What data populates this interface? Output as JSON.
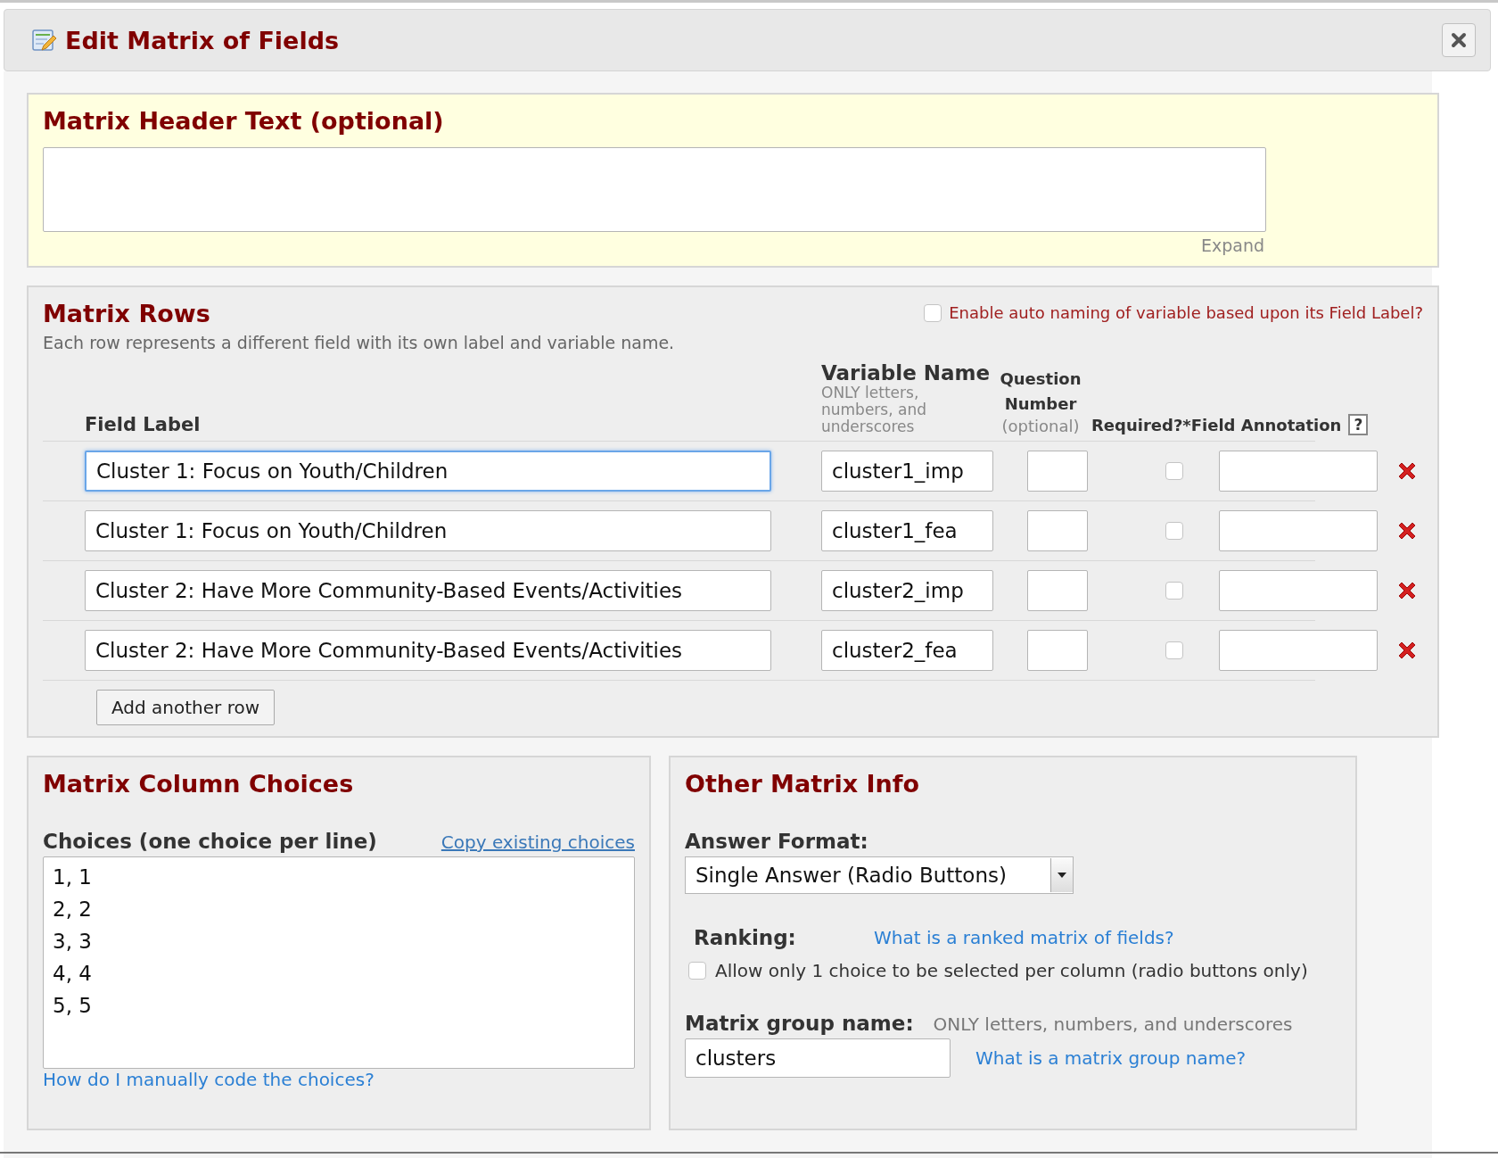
{
  "dialog": {
    "title": "Edit Matrix of Fields"
  },
  "header_section": {
    "title": "Matrix Header Text (optional)",
    "expand_link": "Expand"
  },
  "rows_section": {
    "title": "Matrix Rows",
    "description": "Each row represents a different field with its own label and variable name.",
    "auto_naming": {
      "label": "Enable auto naming of variable based upon its Field Label?",
      "checked": false
    },
    "columns": {
      "field_label": "Field Label",
      "variable_name": "Variable Name",
      "variable_hint": "ONLY letters, numbers, and underscores",
      "question_number": "Question Number",
      "question_hint": "(optional)",
      "required": "Required?",
      "annotation": "*Field Annotation",
      "help": "?"
    },
    "rows": [
      {
        "label": "Cluster 1: Focus on Youth/Children",
        "variable": "cluster1_imp",
        "required": false,
        "focused": true
      },
      {
        "label": "Cluster 1: Focus on Youth/Children",
        "variable": "cluster1_fea",
        "required": false,
        "focused": false
      },
      {
        "label": "Cluster 2: Have More Community-Based Events/Activities",
        "variable": "cluster2_imp",
        "required": false,
        "focused": false
      },
      {
        "label": "Cluster 2: Have More Community-Based Events/Activities",
        "variable": "cluster2_fea",
        "required": false,
        "focused": false
      }
    ],
    "add_button": "Add another row"
  },
  "choices_section": {
    "title": "Matrix Column Choices",
    "label": "Choices (one choice per line)",
    "copy_link": "Copy existing choices",
    "choices": [
      "1, 1",
      "2, 2",
      "3, 3",
      "4, 4",
      "5, 5"
    ],
    "help_link": "How do I manually code the choices?"
  },
  "other_section": {
    "title": "Other Matrix Info",
    "answer_format_label": "Answer Format:",
    "answer_format": "Single Answer (Radio Buttons)",
    "ranking_label": "Ranking:",
    "ranking_link": "What is a ranked matrix of fields?",
    "ranking_option": {
      "label": "Allow only 1 choice to be selected per column (radio buttons only)",
      "checked": false
    },
    "group_name_label": "Matrix group name:",
    "group_name_hint": "ONLY letters, numbers, and underscores",
    "group_name": "clusters",
    "group_name_link": "What is a matrix group name?"
  }
}
